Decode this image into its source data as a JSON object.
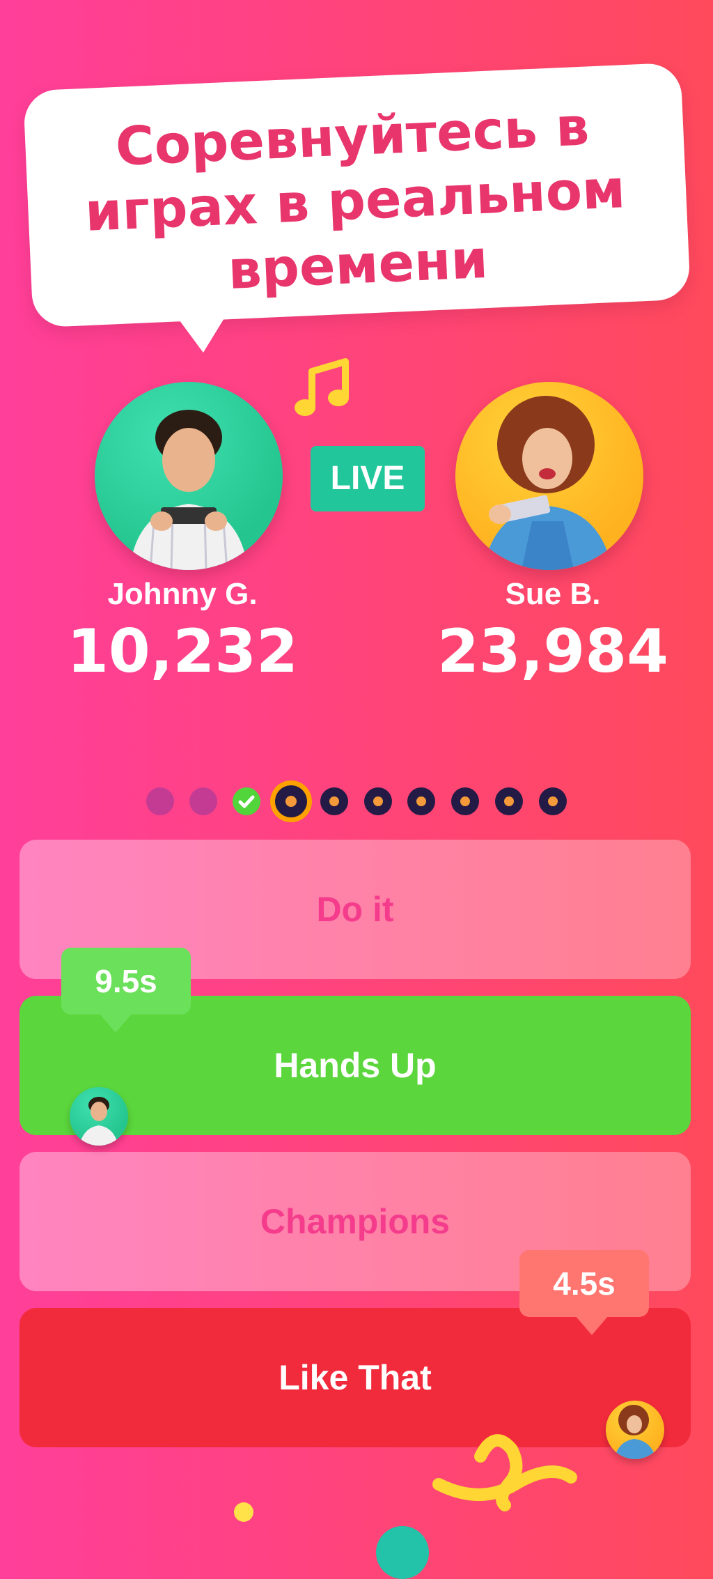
{
  "headline": "Соревнуйтесь в играх в реальном времени",
  "live_badge": "LIVE",
  "players": [
    {
      "name": "Johnny G.",
      "score": "10,232"
    },
    {
      "name": "Sue B.",
      "score": "23,984"
    }
  ],
  "progress": {
    "total": 10,
    "current_index": 3,
    "completed": [
      0,
      1,
      2
    ]
  },
  "answers": [
    {
      "label": "Do it",
      "state": "dim"
    },
    {
      "label": "Hands Up",
      "state": "correct"
    },
    {
      "label": "Champions",
      "state": "dim"
    },
    {
      "label": "Like That",
      "state": "wrong"
    }
  ],
  "timers": {
    "left": "9.5s",
    "right": "4.5s"
  },
  "icons": {
    "music": "music-note-icon",
    "check": "check-icon"
  },
  "colors": {
    "accent_pink": "#e8356c",
    "live_green": "#21c79b",
    "correct_green": "#5bd63c",
    "wrong_red": "#f22b3c",
    "progress_current": "#ffa200"
  }
}
